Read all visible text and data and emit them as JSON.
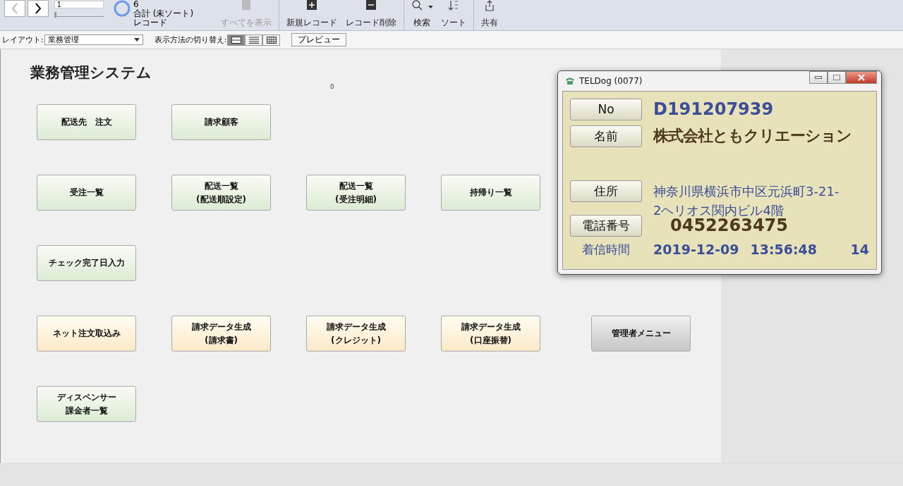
{
  "toolbar": {
    "record_field": "1",
    "slider_level": {
      "level": 0
    },
    "record_count": "6",
    "sort_status": "合計 (未ソート)",
    "records_label": "レコード",
    "actions": [
      {
        "label": "すべてを表示",
        "kind": "showall",
        "disabled": true
      },
      {
        "label": "新規レコード",
        "kind": "new",
        "disabled": false
      },
      {
        "label": "レコード削除",
        "kind": "delete",
        "disabled": false
      },
      {
        "label": "検索",
        "kind": "search",
        "disabled": false
      },
      {
        "label": "ソート",
        "kind": "sort",
        "disabled": false
      },
      {
        "label": "共有",
        "kind": "share",
        "disabled": false
      }
    ]
  },
  "layout_bar": {
    "layout_label": "レイアウト:",
    "layout_value": "業務管理",
    "view_label": "表示方法の切り替え:",
    "views": [
      {
        "kind": "form",
        "selected": true
      },
      {
        "kind": "list",
        "selected": false
      },
      {
        "kind": "table",
        "selected": false
      }
    ],
    "preview": "プレビュー"
  },
  "page": {
    "title": "業務管理システム",
    "counter": "0",
    "rows": [
      [
        {
          "lines": [
            "配送先　注文"
          ],
          "kind": "standard"
        },
        {
          "lines": [
            "請求顧客"
          ],
          "kind": "standard"
        }
      ],
      [
        {
          "lines": [
            "受注一覧"
          ],
          "kind": "standard"
        },
        {
          "lines": [
            "配送一覧",
            "(配送順設定)"
          ],
          "kind": "standard"
        },
        {
          "lines": [
            "配送一覧",
            "(受注明細)"
          ],
          "kind": "standard"
        },
        {
          "lines": [
            "持帰り一覧"
          ],
          "kind": "standard"
        }
      ],
      [
        {
          "lines": [
            "チェック完了日入力"
          ],
          "kind": "standard"
        }
      ],
      [
        {
          "lines": [
            "ネット注文取込み"
          ],
          "kind": "billing"
        },
        {
          "lines": [
            "請求データ生成",
            "(請求書)"
          ],
          "kind": "billing"
        },
        {
          "lines": [
            "請求データ生成",
            "(クレジット)"
          ],
          "kind": "billing"
        },
        {
          "lines": [
            "請求データ生成",
            "(口座振替)"
          ],
          "kind": "billing"
        },
        {
          "lines": [
            "管理者メニュー"
          ],
          "kind": "admin"
        }
      ],
      [
        {
          "lines": [
            "ディスペンサー",
            "課金者一覧"
          ],
          "kind": "standard"
        }
      ]
    ]
  },
  "popup": {
    "title": "TELDog (0077)",
    "no_label": "No",
    "no_value": "D191207939",
    "name_label": "名前",
    "name_value": "株式会社ともクリエーション",
    "address_label": "住所",
    "address_value": "神奈川県横浜市中区元浜町3-21-2ヘリオス関内ビル4階",
    "phone_label": "電話番号",
    "phone_value": "0452263475",
    "time_label": "着信時間",
    "date": "2019-12-09",
    "time": "13:56:48",
    "count": "14"
  }
}
